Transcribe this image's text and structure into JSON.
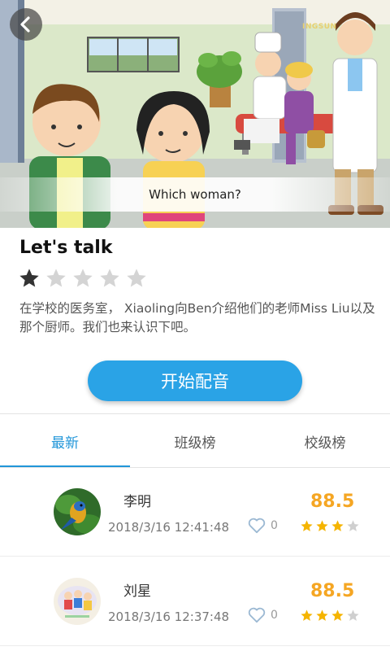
{
  "caption": "Which woman?",
  "brand_watermark": "INGSUN",
  "lesson": {
    "title": "Let's talk",
    "rating": 1,
    "rating_max": 5,
    "description": "在学校的医务室， Xiaoling向Ben介绍他们的老师Miss Liu以及那个厨师。我们也来认识下吧。"
  },
  "start_button": "开始配音",
  "tabs": [
    {
      "label": "最新",
      "active": true
    },
    {
      "label": "班级榜",
      "active": false
    },
    {
      "label": "校级榜",
      "active": false
    }
  ],
  "entries": [
    {
      "name": "李明",
      "time": "2018/3/16 12:41:48",
      "likes": "0",
      "score": "88.5",
      "stars": 3,
      "stars_max": 4
    },
    {
      "name": "刘星",
      "time": "2018/3/16 12:37:48",
      "likes": "0",
      "score": "88.5",
      "stars": 3,
      "stars_max": 4
    }
  ],
  "colors": {
    "accent": "#2aa3e6",
    "tab_active": "#2196d9",
    "score": "#f5a623",
    "star_filled": "#f5b400",
    "star_empty": "#cfcfcf"
  }
}
